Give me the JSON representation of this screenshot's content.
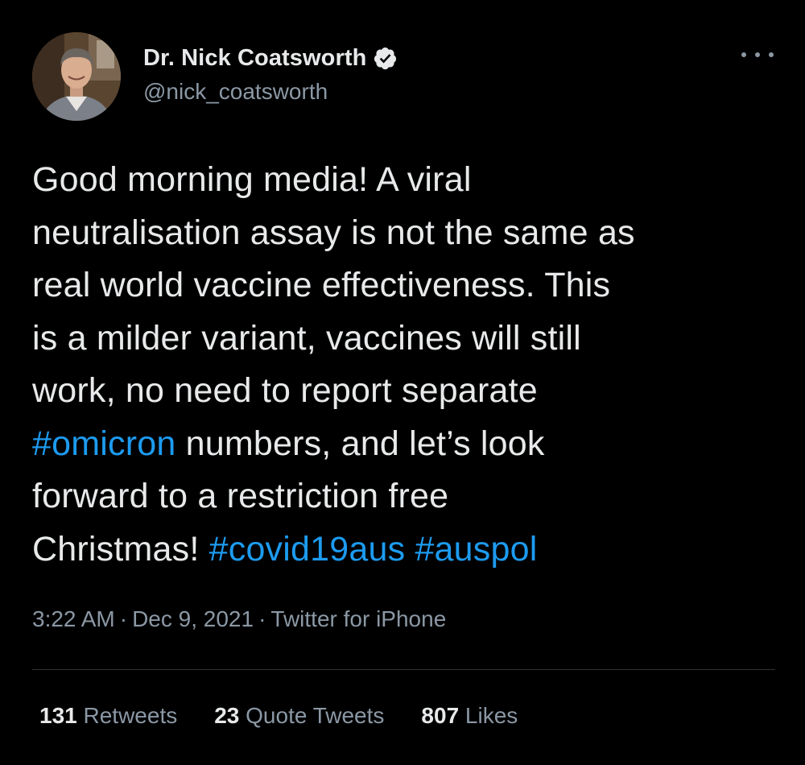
{
  "tweet": {
    "author": {
      "display_name": "Dr. Nick Coatsworth",
      "handle": "@nick_coatsworth",
      "verified": true,
      "avatar_icon": "profile-photo"
    },
    "text_lines": [
      [
        {
          "t": "Good morning media! A viral",
          "tag": false
        }
      ],
      [
        {
          "t": "neutralisation assay is not the same as",
          "tag": false
        }
      ],
      [
        {
          "t": "real world vaccine effectiveness. This",
          "tag": false
        }
      ],
      [
        {
          "t": "is a milder variant, vaccines will still",
          "tag": false
        }
      ],
      [
        {
          "t": "work, no need to report separate",
          "tag": false
        }
      ],
      [
        {
          "t": "#omicron",
          "tag": true
        },
        {
          "t": " numbers, and let’s look",
          "tag": false
        }
      ],
      [
        {
          "t": "forward to a restriction free",
          "tag": false
        }
      ],
      [
        {
          "t": "Christmas! ",
          "tag": false
        },
        {
          "t": "#covid19aus",
          "tag": true
        },
        {
          "t": " ",
          "tag": false
        },
        {
          "t": "#auspol",
          "tag": true
        }
      ]
    ],
    "hashtags": [
      "#omicron",
      "#covid19aus",
      "#auspol"
    ],
    "time": "3:22 AM",
    "separator": "·",
    "date": "Dec 9, 2021",
    "source": "Twitter for iPhone",
    "stats": {
      "retweets_count": "131",
      "retweets_label": "Retweets",
      "quotes_count": "23",
      "quotes_label": "Quote Tweets",
      "likes_count": "807",
      "likes_label": "Likes"
    }
  },
  "colors": {
    "background": "#000000",
    "text": "#e7e9ea",
    "secondary": "#8b98a5",
    "hashtag": "#1d9bf0",
    "divider": "#2f3336"
  },
  "icons": {
    "verified": "verified-badge-icon",
    "more": "more-options-icon"
  }
}
